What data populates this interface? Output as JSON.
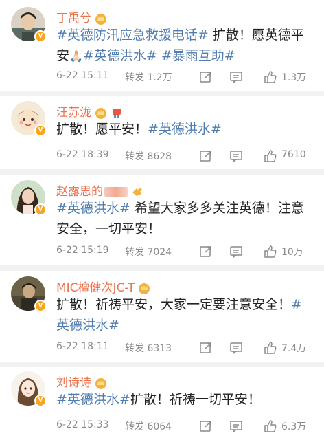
{
  "posts": [
    {
      "username": "丁禹兮",
      "avatar_icon": "avatar-man-photo",
      "badge": "v",
      "content": [
        {
          "type": "topic",
          "text": "#英德防汛应急救援电话#"
        },
        {
          "type": "text",
          "text": " 扩散！愿英德平安"
        },
        {
          "type": "emoji",
          "text": "🙏🏻"
        },
        {
          "type": "topic",
          "text": "#英德洪水#"
        },
        {
          "type": "text",
          "text": " "
        },
        {
          "type": "topic",
          "text": "#暴雨互助#"
        }
      ],
      "time": "6-22 15:11",
      "repost_label": "转发",
      "repost_count": "1.2万",
      "likes": "1.3万"
    },
    {
      "username": "汪苏泷",
      "avatar_icon": "avatar-cartoon-baby",
      "badge": "v",
      "content": [
        {
          "type": "text",
          "text": "扩散！愿平安！"
        },
        {
          "type": "topic",
          "text": "#英德洪水#"
        }
      ],
      "time": "6-22 18:39",
      "repost_label": "转发",
      "repost_count": "8628",
      "likes": "7610"
    },
    {
      "username": "赵露思的",
      "avatar_icon": "avatar-woman-photo",
      "badge": "v",
      "content": [
        {
          "type": "topic",
          "text": "#英德洪水#"
        },
        {
          "type": "text",
          "text": " 希望大家多多关注英德！注意安全，一切平安！"
        }
      ],
      "time": "6-22 15:19",
      "repost_label": "转发",
      "repost_count": "7024",
      "likes": "10万"
    },
    {
      "username": "MIC檀健次JC-T",
      "avatar_icon": "avatar-man-photo",
      "badge": "v",
      "content": [
        {
          "type": "text",
          "text": "扩散！祈祷平安，大家一定要注意安全！"
        },
        {
          "type": "topic",
          "text": "#英德洪水#"
        }
      ],
      "time": "6-22 18:11",
      "repost_label": "转发",
      "repost_count": "6313",
      "likes": "7.4万"
    },
    {
      "username": "刘诗诗",
      "avatar_icon": "avatar-cartoon-girl",
      "badge": "v",
      "content": [
        {
          "type": "topic",
          "text": "#英德洪水#"
        },
        {
          "type": "text",
          "text": "扩散！祈祷一切平安！"
        }
      ],
      "time": "6-22 15:33",
      "repost_label": "转发",
      "repost_count": "6064",
      "likes": "6.3万"
    }
  ],
  "colors": {
    "username": "#eb7350",
    "topic": "#507daf",
    "meta": "#8a8a8a",
    "separator": "#f2f2f2",
    "verified": "#f6a623"
  },
  "icons": [
    "crown-icon",
    "comment-icon",
    "share-icon",
    "more-icon",
    "like-icon",
    "verified-icon"
  ]
}
